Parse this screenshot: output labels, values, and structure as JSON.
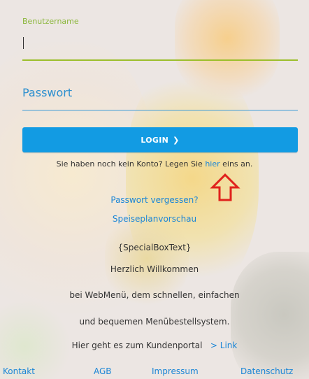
{
  "login": {
    "username_label": "Benutzername",
    "username_value": "",
    "password_label": "Passwort",
    "login_button_label": "LOGIN",
    "login_button_icon": "chevron-right-icon",
    "register_prefix": "Sie haben noch kein Konto? Legen Sie ",
    "register_link": "hier",
    "register_suffix": " eins an.",
    "annotation_icon": "red-up-arrow-icon"
  },
  "links": {
    "forgot_password": "Passwort vergessen?",
    "menu_preview": "Speiseplanvorschau"
  },
  "info": {
    "special_box": "{SpecialBoxText}",
    "welcome": "Herzlich Willkommen",
    "line1": "bei WebMenü, dem schnellen, einfachen",
    "line2": "und bequemen Menübestellsystem.",
    "portal_text": "Hier geht es zum Kundenportal",
    "portal_link": "> Link"
  },
  "footer": {
    "contact": "Kontakt",
    "terms": "AGB",
    "imprint": "Impressum",
    "privacy": "Datenschutz"
  },
  "colors": {
    "accent_green": "#9cbf2c",
    "accent_blue": "#129be3",
    "link_blue": "#1b86d6",
    "arrow_red": "#e0221c"
  }
}
